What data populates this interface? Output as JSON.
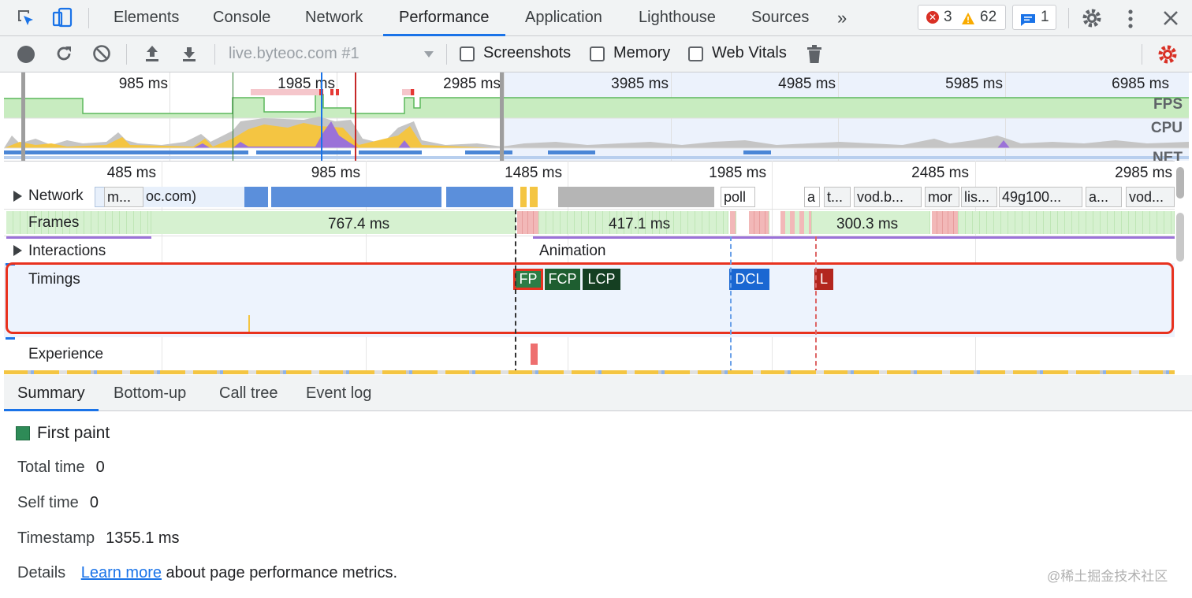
{
  "devtools": {
    "tabs": [
      "Elements",
      "Console",
      "Network",
      "Performance",
      "Application",
      "Lighthouse",
      "Sources"
    ],
    "active_tab": "Performance",
    "more_tabs": "»",
    "errors_count": "3",
    "warnings_count": "62",
    "messages_count": "1"
  },
  "toolbar": {
    "recording_target": "live.byteoc.com #1",
    "checkboxes": [
      {
        "label": "Screenshots",
        "checked": false
      },
      {
        "label": "Memory",
        "checked": false
      },
      {
        "label": "Web Vitals",
        "checked": false
      }
    ]
  },
  "overview": {
    "ticks": [
      "985 ms",
      "1985 ms",
      "2985 ms",
      "3985 ms",
      "4985 ms",
      "5985 ms",
      "6985 ms"
    ],
    "labels": {
      "fps": "FPS",
      "cpu": "CPU",
      "net": "NET"
    }
  },
  "timeline": {
    "ticks": [
      "485 ms",
      "985 ms",
      "1485 ms",
      "1985 ms",
      "2485 ms",
      "2985 ms"
    ],
    "tracks": {
      "network": "Network",
      "frames": "Frames",
      "interactions": "Interactions",
      "timings": "Timings",
      "experience": "Experience"
    },
    "network_items": [
      "m...",
      "oc.com)",
      "poll",
      "a",
      "t...",
      "vod.b...",
      "mor",
      "lis...",
      "49g100...",
      "a...",
      "vod..."
    ],
    "frame_durations": [
      "767.4 ms",
      "417.1 ms",
      "300.3 ms"
    ],
    "animation_label": "Animation",
    "timing_markers": [
      {
        "label": "FP",
        "color": "#2e7d46"
      },
      {
        "label": "FCP",
        "color": "#1e5e30"
      },
      {
        "label": "LCP",
        "color": "#153f22"
      },
      {
        "label": "DCL",
        "color": "#1a67d2"
      },
      {
        "label": "L",
        "color": "#b3261e"
      }
    ]
  },
  "bottom": {
    "tabs": [
      "Summary",
      "Bottom-up",
      "Call tree",
      "Event log"
    ],
    "active_tab": "Summary",
    "summary": {
      "title": "First paint",
      "total_time_label": "Total time",
      "total_time": "0",
      "self_time_label": "Self time",
      "self_time": "0",
      "timestamp_label": "Timestamp",
      "timestamp": "1355.1 ms",
      "details_label": "Details",
      "details_link": "Learn more",
      "details_text": "about page performance metrics."
    },
    "watermark": "@稀土掘金技术社区"
  },
  "colors": {
    "accent": "#1a73e8",
    "highlight_box": "#e8321f",
    "fps_fill": "#c8ecc0",
    "frame_fill": "#d6f1d0",
    "dropped_frame": "#f2b8b8"
  }
}
